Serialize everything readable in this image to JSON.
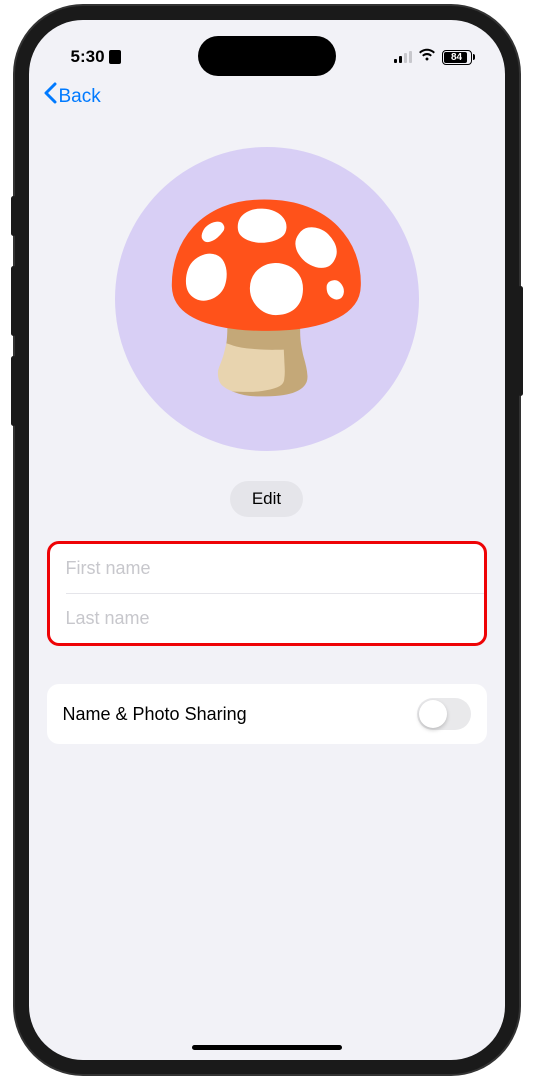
{
  "status_bar": {
    "time": "5:30",
    "battery_level": "84"
  },
  "nav": {
    "back_label": "Back"
  },
  "profile": {
    "avatar_emoji": "🍄",
    "edit_label": "Edit",
    "first_name_placeholder": "First name",
    "first_name_value": "",
    "last_name_placeholder": "Last name",
    "last_name_value": ""
  },
  "sharing": {
    "label": "Name & Photo Sharing",
    "enabled": false
  }
}
